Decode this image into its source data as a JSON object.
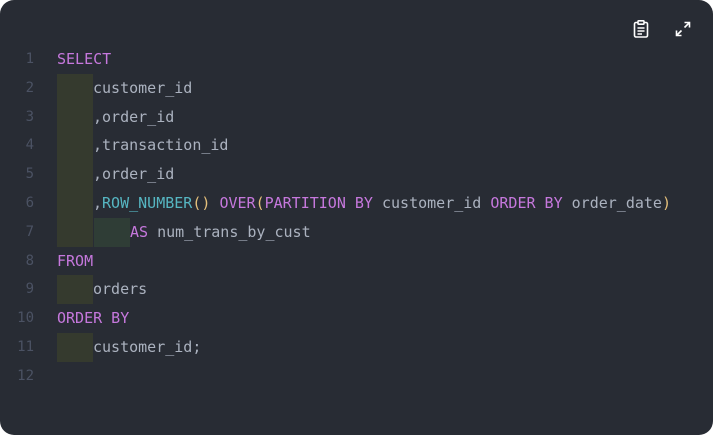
{
  "toolbar": {
    "copy_icon": "clipboard-icon",
    "expand_icon": "expand-icon"
  },
  "lines": [
    {
      "n": "1",
      "tokens": [
        [
          "SELECT",
          "kw"
        ]
      ]
    },
    {
      "n": "2",
      "tokens": [
        [
          "customer_id",
          "plain"
        ]
      ]
    },
    {
      "n": "3",
      "tokens": [
        [
          ",order_id",
          "plain"
        ]
      ]
    },
    {
      "n": "4",
      "tokens": [
        [
          ",transaction_id",
          "plain"
        ]
      ]
    },
    {
      "n": "5",
      "tokens": [
        [
          ",order_id",
          "plain"
        ]
      ]
    },
    {
      "n": "6",
      "tokens": [
        [
          ",",
          "plain"
        ],
        [
          "ROW_NUMBER",
          "fn"
        ],
        [
          "()",
          "par1"
        ],
        [
          " ",
          "plain"
        ],
        [
          "OVER",
          "kw"
        ],
        [
          "(",
          "par1"
        ],
        [
          "PARTITION BY",
          "kw"
        ],
        [
          " customer_id ",
          "plain"
        ],
        [
          "ORDER BY",
          "kw"
        ],
        [
          " order_date",
          "plain"
        ],
        [
          ")",
          "par1"
        ]
      ]
    },
    {
      "n": "7",
      "tokens": [
        [
          "AS",
          "kw"
        ],
        [
          " num_trans_by_cust",
          "plain"
        ]
      ]
    },
    {
      "n": "8",
      "tokens": [
        [
          "FROM",
          "kw"
        ]
      ]
    },
    {
      "n": "9",
      "tokens": [
        [
          "orders",
          "plain"
        ]
      ]
    },
    {
      "n": "10",
      "tokens": [
        [
          "ORDER BY",
          "kw"
        ]
      ]
    },
    {
      "n": "11",
      "tokens": [
        [
          "customer_id;",
          "plain"
        ]
      ]
    },
    {
      "n": "12",
      "tokens": []
    }
  ],
  "indent": [
    0,
    1,
    1,
    1,
    1,
    1,
    2,
    0,
    1,
    0,
    1,
    0
  ],
  "colors": {
    "background": "#282c34",
    "keyword": "#c678dd",
    "function": "#56b6c2",
    "paren": "#e5c07b",
    "text": "#abb2bf",
    "line_number": "#4b5263",
    "indent_guide_1": "#353a2e",
    "indent_guide_2": "#2f3d36"
  }
}
